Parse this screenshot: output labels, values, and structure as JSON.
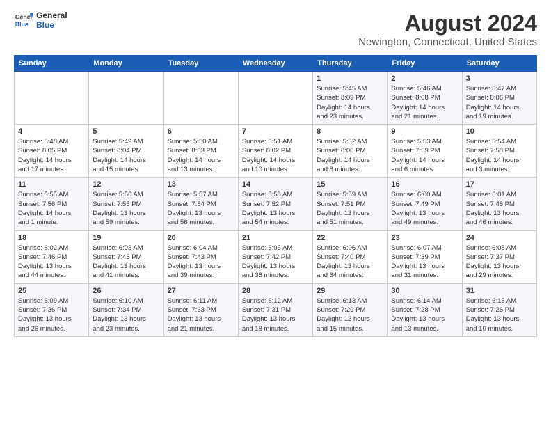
{
  "logo": {
    "line1": "General",
    "line2": "Blue"
  },
  "title": "August 2024",
  "subtitle": "Newington, Connecticut, United States",
  "days_of_week": [
    "Sunday",
    "Monday",
    "Tuesday",
    "Wednesday",
    "Thursday",
    "Friday",
    "Saturday"
  ],
  "weeks": [
    [
      {
        "day": "",
        "info": ""
      },
      {
        "day": "",
        "info": ""
      },
      {
        "day": "",
        "info": ""
      },
      {
        "day": "",
        "info": ""
      },
      {
        "day": "1",
        "info": "Sunrise: 5:45 AM\nSunset: 8:09 PM\nDaylight: 14 hours\nand 23 minutes."
      },
      {
        "day": "2",
        "info": "Sunrise: 5:46 AM\nSunset: 8:08 PM\nDaylight: 14 hours\nand 21 minutes."
      },
      {
        "day": "3",
        "info": "Sunrise: 5:47 AM\nSunset: 8:06 PM\nDaylight: 14 hours\nand 19 minutes."
      }
    ],
    [
      {
        "day": "4",
        "info": "Sunrise: 5:48 AM\nSunset: 8:05 PM\nDaylight: 14 hours\nand 17 minutes."
      },
      {
        "day": "5",
        "info": "Sunrise: 5:49 AM\nSunset: 8:04 PM\nDaylight: 14 hours\nand 15 minutes."
      },
      {
        "day": "6",
        "info": "Sunrise: 5:50 AM\nSunset: 8:03 PM\nDaylight: 14 hours\nand 13 minutes."
      },
      {
        "day": "7",
        "info": "Sunrise: 5:51 AM\nSunset: 8:02 PM\nDaylight: 14 hours\nand 10 minutes."
      },
      {
        "day": "8",
        "info": "Sunrise: 5:52 AM\nSunset: 8:00 PM\nDaylight: 14 hours\nand 8 minutes."
      },
      {
        "day": "9",
        "info": "Sunrise: 5:53 AM\nSunset: 7:59 PM\nDaylight: 14 hours\nand 6 minutes."
      },
      {
        "day": "10",
        "info": "Sunrise: 5:54 AM\nSunset: 7:58 PM\nDaylight: 14 hours\nand 3 minutes."
      }
    ],
    [
      {
        "day": "11",
        "info": "Sunrise: 5:55 AM\nSunset: 7:56 PM\nDaylight: 14 hours\nand 1 minute."
      },
      {
        "day": "12",
        "info": "Sunrise: 5:56 AM\nSunset: 7:55 PM\nDaylight: 13 hours\nand 59 minutes."
      },
      {
        "day": "13",
        "info": "Sunrise: 5:57 AM\nSunset: 7:54 PM\nDaylight: 13 hours\nand 56 minutes."
      },
      {
        "day": "14",
        "info": "Sunrise: 5:58 AM\nSunset: 7:52 PM\nDaylight: 13 hours\nand 54 minutes."
      },
      {
        "day": "15",
        "info": "Sunrise: 5:59 AM\nSunset: 7:51 PM\nDaylight: 13 hours\nand 51 minutes."
      },
      {
        "day": "16",
        "info": "Sunrise: 6:00 AM\nSunset: 7:49 PM\nDaylight: 13 hours\nand 49 minutes."
      },
      {
        "day": "17",
        "info": "Sunrise: 6:01 AM\nSunset: 7:48 PM\nDaylight: 13 hours\nand 46 minutes."
      }
    ],
    [
      {
        "day": "18",
        "info": "Sunrise: 6:02 AM\nSunset: 7:46 PM\nDaylight: 13 hours\nand 44 minutes."
      },
      {
        "day": "19",
        "info": "Sunrise: 6:03 AM\nSunset: 7:45 PM\nDaylight: 13 hours\nand 41 minutes."
      },
      {
        "day": "20",
        "info": "Sunrise: 6:04 AM\nSunset: 7:43 PM\nDaylight: 13 hours\nand 39 minutes."
      },
      {
        "day": "21",
        "info": "Sunrise: 6:05 AM\nSunset: 7:42 PM\nDaylight: 13 hours\nand 36 minutes."
      },
      {
        "day": "22",
        "info": "Sunrise: 6:06 AM\nSunset: 7:40 PM\nDaylight: 13 hours\nand 34 minutes."
      },
      {
        "day": "23",
        "info": "Sunrise: 6:07 AM\nSunset: 7:39 PM\nDaylight: 13 hours\nand 31 minutes."
      },
      {
        "day": "24",
        "info": "Sunrise: 6:08 AM\nSunset: 7:37 PM\nDaylight: 13 hours\nand 29 minutes."
      }
    ],
    [
      {
        "day": "25",
        "info": "Sunrise: 6:09 AM\nSunset: 7:36 PM\nDaylight: 13 hours\nand 26 minutes."
      },
      {
        "day": "26",
        "info": "Sunrise: 6:10 AM\nSunset: 7:34 PM\nDaylight: 13 hours\nand 23 minutes."
      },
      {
        "day": "27",
        "info": "Sunrise: 6:11 AM\nSunset: 7:33 PM\nDaylight: 13 hours\nand 21 minutes."
      },
      {
        "day": "28",
        "info": "Sunrise: 6:12 AM\nSunset: 7:31 PM\nDaylight: 13 hours\nand 18 minutes."
      },
      {
        "day": "29",
        "info": "Sunrise: 6:13 AM\nSunset: 7:29 PM\nDaylight: 13 hours\nand 15 minutes."
      },
      {
        "day": "30",
        "info": "Sunrise: 6:14 AM\nSunset: 7:28 PM\nDaylight: 13 hours\nand 13 minutes."
      },
      {
        "day": "31",
        "info": "Sunrise: 6:15 AM\nSunset: 7:26 PM\nDaylight: 13 hours\nand 10 minutes."
      }
    ]
  ]
}
